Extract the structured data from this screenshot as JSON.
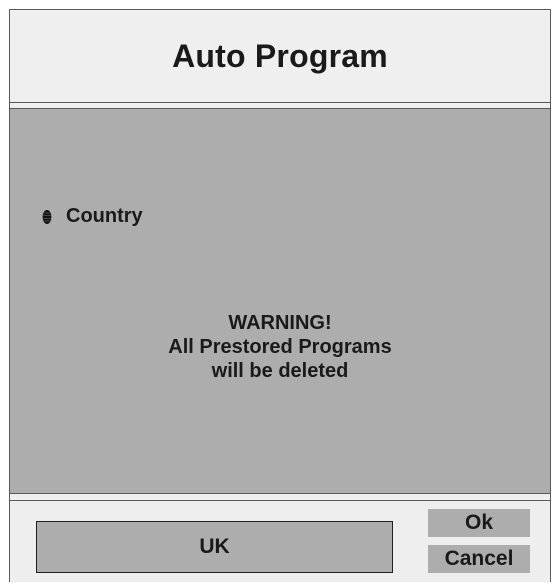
{
  "window": {
    "title": "Auto Program"
  },
  "settings": {
    "country_label": "Country",
    "country_icon": "bullet-icon",
    "country_value": "UK"
  },
  "warning": {
    "line1": "WARNING!",
    "line2": "All Prestored Programs",
    "line3": "will be deleted"
  },
  "buttons": {
    "ok_label": "Ok",
    "cancel_label": "Cancel"
  },
  "colors": {
    "panel_gray": "#adadad",
    "background_light": "#eeeeee",
    "text_dark": "#1a1a1a"
  }
}
